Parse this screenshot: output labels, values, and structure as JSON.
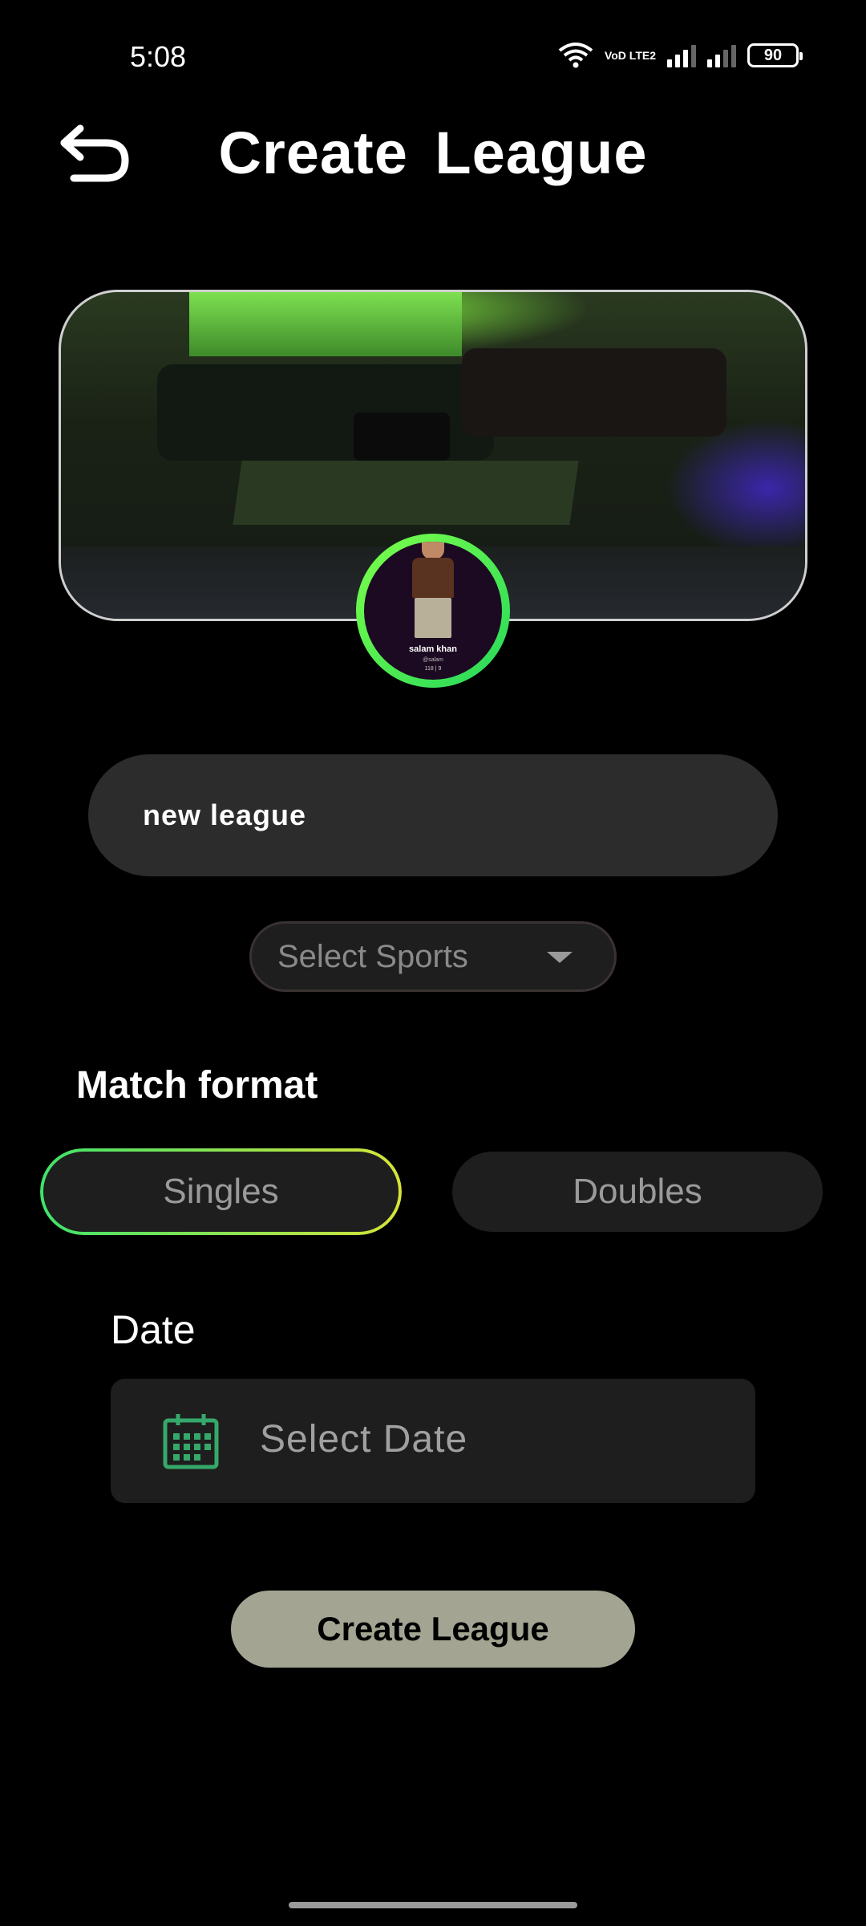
{
  "status_bar": {
    "time": "5:08",
    "network_label": "VoD LTE2",
    "battery": "90"
  },
  "header": {
    "title": "Create  League",
    "back_icon": "back-arrow-icon"
  },
  "banner": {
    "avatar": {
      "name": "salam khan",
      "handle": "@salam",
      "stats": "118 | 9"
    }
  },
  "form": {
    "league_name_value": "new league",
    "sports_select_label": "Select Sports",
    "match_format_title": "Match format",
    "format_options": [
      "Singles",
      "Doubles"
    ],
    "selected_format": "Singles",
    "date_label": "Date",
    "date_placeholder": "Select Date",
    "create_button": "Create League"
  },
  "colors": {
    "background": "#000000",
    "input_bg": "#2c2c2c",
    "field_bg": "#1e1e1e",
    "accent_green": "#3fe36a",
    "accent_yellow": "#d6e43a",
    "calendar_icon": "#35a86a",
    "create_button_bg": "#a3a592"
  }
}
